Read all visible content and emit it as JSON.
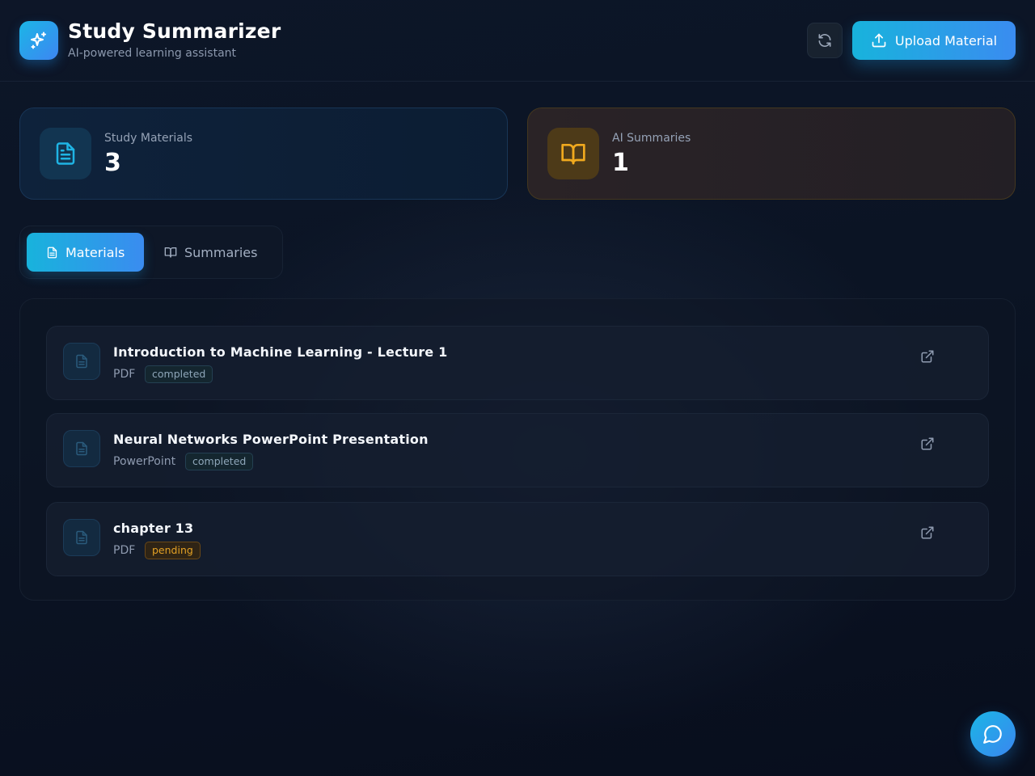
{
  "header": {
    "title": "Study Summarizer",
    "subtitle": "AI-powered learning assistant",
    "logo_icon": "sparkles-icon",
    "refresh_icon": "refresh-icon",
    "upload_label": "Upload Material",
    "upload_icon": "upload-icon"
  },
  "stats": {
    "materials": {
      "label": "Study Materials",
      "value": "3",
      "icon": "file-text-icon"
    },
    "summaries": {
      "label": "AI Summaries",
      "value": "1",
      "icon": "book-open-icon"
    }
  },
  "tabs": [
    {
      "label": "Materials",
      "icon": "file-text-icon",
      "active": true
    },
    {
      "label": "Summaries",
      "icon": "book-open-icon",
      "active": false
    }
  ],
  "materials": [
    {
      "title": "Introduction to Machine Learning - Lecture 1",
      "type": "PDF",
      "status": "completed"
    },
    {
      "title": "Neural Networks PowerPoint Presentation",
      "type": "PowerPoint",
      "status": "completed"
    },
    {
      "title": "chapter 13",
      "type": "PDF",
      "status": "pending"
    }
  ],
  "chat": {
    "icon": "message-circle-icon"
  },
  "colors": {
    "accent_start": "#18b3dc",
    "accent_end": "#3a8cf0",
    "pending": "#e3a125",
    "completed": "#8ea6b9"
  }
}
